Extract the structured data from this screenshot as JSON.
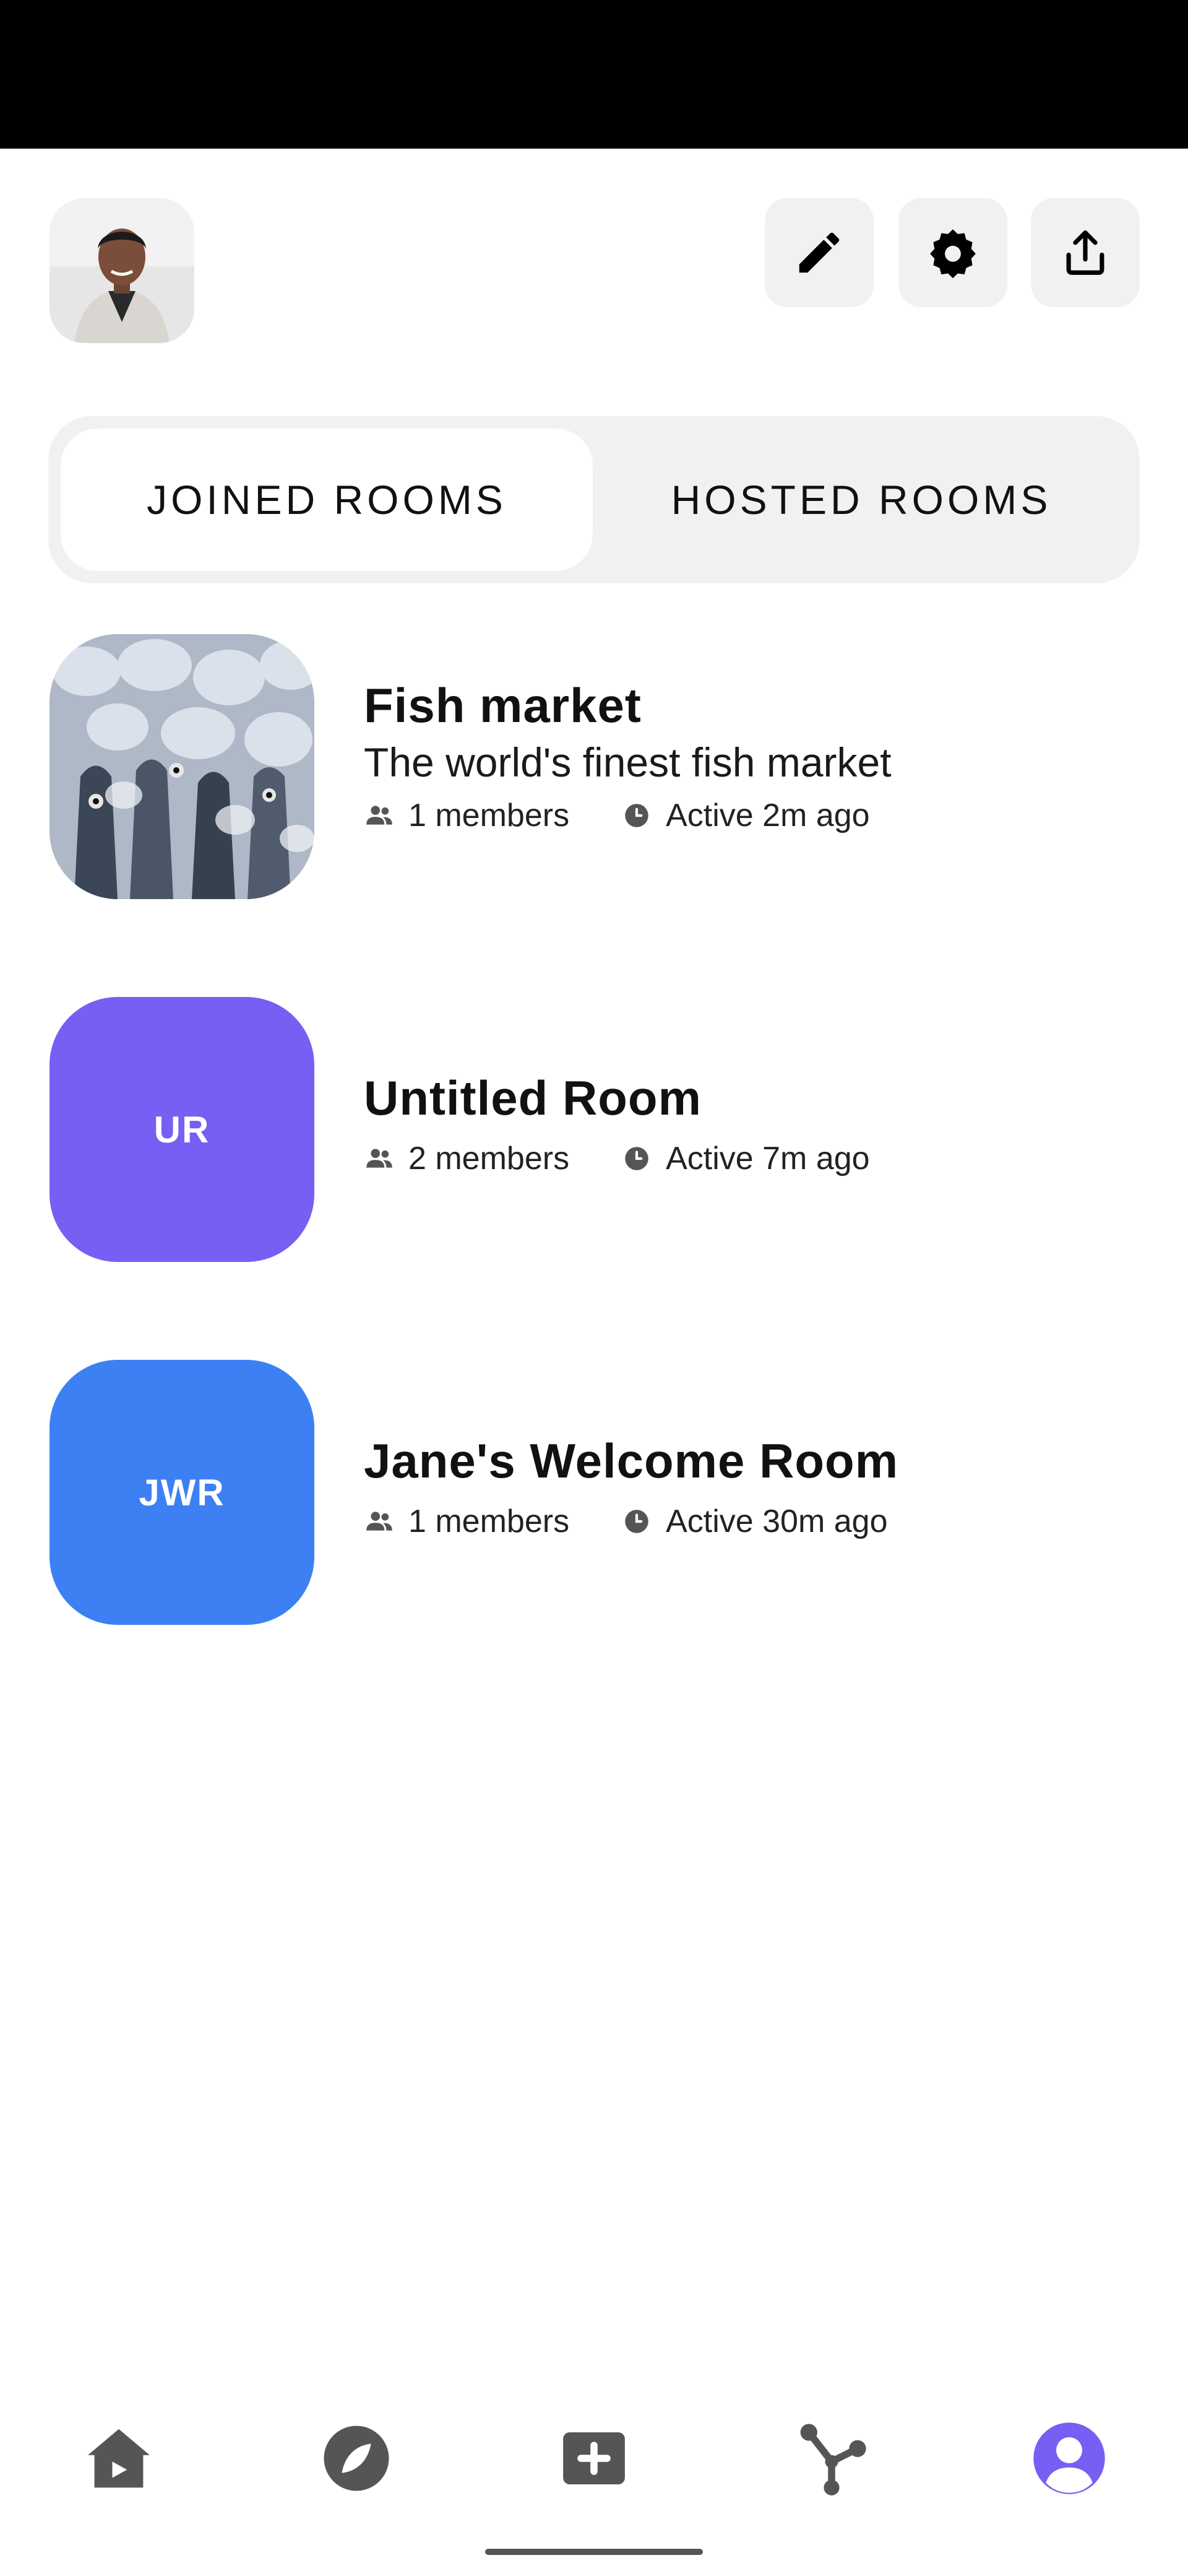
{
  "header": {
    "avatar_alt": "profile-avatar",
    "buttons": [
      {
        "name": "edit-button",
        "icon": "pencil-icon"
      },
      {
        "name": "settings-button",
        "icon": "gear-icon"
      },
      {
        "name": "share-button",
        "icon": "share-icon"
      }
    ]
  },
  "tabs": {
    "joined": "JOINED ROOMS",
    "hosted": "HOSTED ROOMS",
    "selected": "joined"
  },
  "rooms": [
    {
      "name": "Fish market",
      "description": "The world's finest fish market",
      "members": "1 members",
      "active": "Active 2m ago",
      "thumb": "image"
    },
    {
      "name": "Untitled Room",
      "initials": "UR",
      "members": "2 members",
      "active": "Active 7m ago",
      "color": "#7560f3"
    },
    {
      "name": "Jane's Welcome Room",
      "initials": "JWR",
      "members": "1 members",
      "active": "Active 30m ago",
      "color": "#3d80f4"
    }
  ],
  "nav": {
    "items": [
      "home-icon",
      "explore-icon",
      "add-icon",
      "network-icon",
      "profile-icon"
    ],
    "accent": "#7560f3",
    "icon_color": "#555555"
  }
}
